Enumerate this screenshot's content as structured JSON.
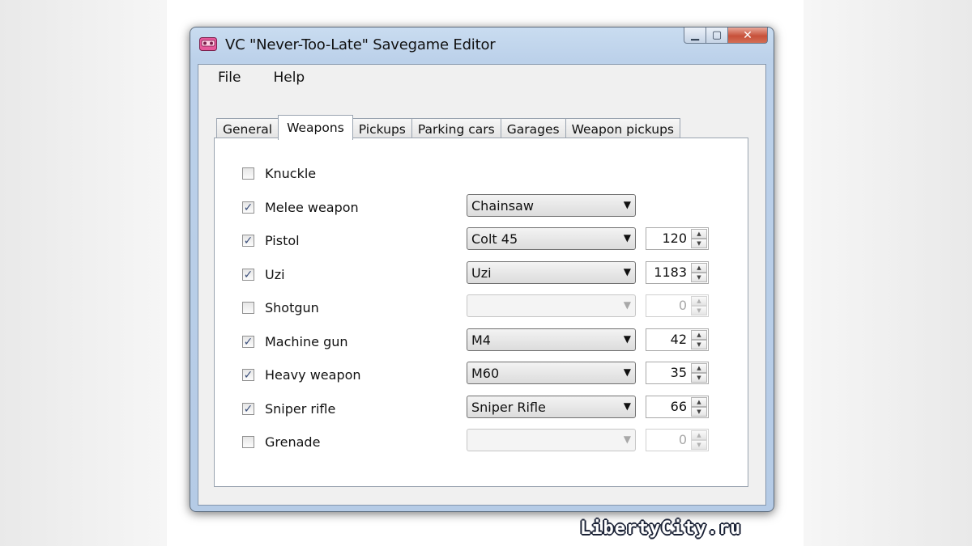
{
  "window": {
    "title": "VC \"Never-Too-Late\" Savegame Editor",
    "icon": "cassette-icon",
    "buttons": {
      "minimize": "▁",
      "maximize": "▢",
      "close": "✕"
    }
  },
  "menu": {
    "items": [
      {
        "label": "File"
      },
      {
        "label": "Help"
      }
    ]
  },
  "tabs": [
    {
      "label": "General",
      "active": false
    },
    {
      "label": "Weapons",
      "active": true
    },
    {
      "label": "Pickups",
      "active": false
    },
    {
      "label": "Parking cars",
      "active": false
    },
    {
      "label": "Garages",
      "active": false
    },
    {
      "label": "Weapon pickups",
      "active": false
    }
  ],
  "weapons": [
    {
      "label": "Knuckle",
      "checked": false,
      "has_combo": false,
      "has_ammo": false
    },
    {
      "label": "Melee weapon",
      "checked": true,
      "has_combo": true,
      "weapon": "Chainsaw",
      "enabled": true,
      "has_ammo": false
    },
    {
      "label": "Pistol",
      "checked": true,
      "has_combo": true,
      "weapon": "Colt 45",
      "enabled": true,
      "has_ammo": true,
      "ammo": "120"
    },
    {
      "label": "Uzi",
      "checked": true,
      "has_combo": true,
      "weapon": "Uzi",
      "enabled": true,
      "has_ammo": true,
      "ammo": "1183"
    },
    {
      "label": "Shotgun",
      "checked": false,
      "has_combo": true,
      "weapon": "",
      "enabled": false,
      "has_ammo": true,
      "ammo": "0"
    },
    {
      "label": "Machine gun",
      "checked": true,
      "has_combo": true,
      "weapon": "M4",
      "enabled": true,
      "has_ammo": true,
      "ammo": "42"
    },
    {
      "label": "Heavy weapon",
      "checked": true,
      "has_combo": true,
      "weapon": "M60",
      "enabled": true,
      "has_ammo": true,
      "ammo": "35"
    },
    {
      "label": "Sniper rifle",
      "checked": true,
      "has_combo": true,
      "weapon": "Sniper Rifle",
      "enabled": true,
      "has_ammo": true,
      "ammo": "66"
    },
    {
      "label": "Grenade",
      "checked": false,
      "has_combo": true,
      "weapon": "",
      "enabled": false,
      "has_ammo": true,
      "ammo": "0"
    }
  ],
  "glyphs": {
    "check": "✓",
    "dropdown": "▼",
    "spin_up": "▲",
    "spin_down": "▼"
  },
  "watermark": "LibertyCity.ru"
}
